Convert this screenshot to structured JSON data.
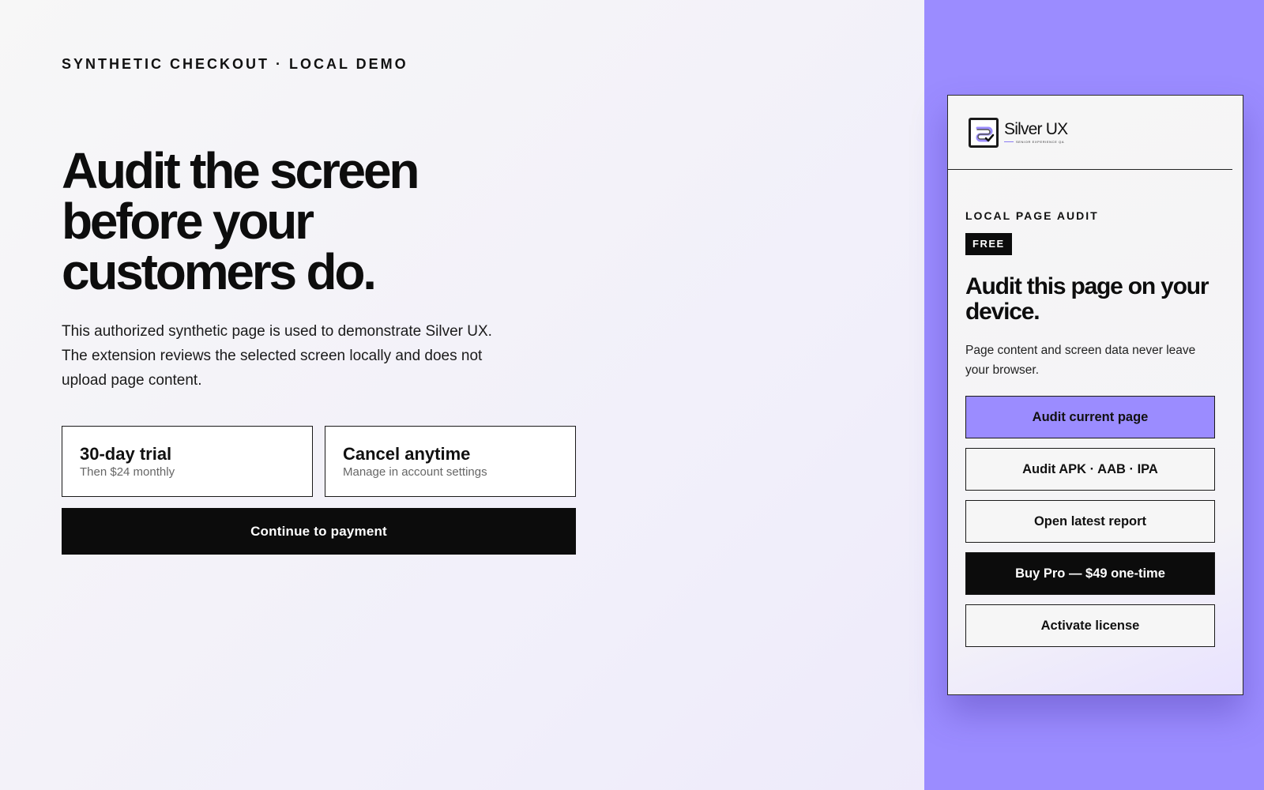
{
  "page": {
    "eyebrow": "SYNTHETIC CHECKOUT · LOCAL DEMO",
    "headline": "Audit the screen before your customers do.",
    "lede": "This authorized synthetic page is used to demonstrate Silver UX. The extension reviews the selected screen locally and does not upload page content.",
    "cards": [
      {
        "title": "30-day trial",
        "subtitle": "Then $24 monthly"
      },
      {
        "title": "Cancel anytime",
        "subtitle": "Manage in account settings"
      }
    ],
    "cta_label": "Continue to payment"
  },
  "popup": {
    "brand": {
      "name": "Silver UX",
      "tagline": "SENIOR EXPERIENCE QA",
      "icon": "silver-ux-logo"
    },
    "eyebrow": "LOCAL PAGE AUDIT",
    "badge": "FREE",
    "title": "Audit this page on your device.",
    "description": "Page content and screen data never leave your browser.",
    "buttons": {
      "audit_page": "Audit current page",
      "audit_app": "Audit APK · AAB · IPA",
      "open_report": "Open latest report",
      "buy_pro": "Buy Pro — $49 one-time",
      "activate": "Activate license"
    }
  },
  "colors": {
    "accent": "#9b8cff",
    "ink": "#0c0c0c",
    "surface": "#f6f6f6"
  }
}
